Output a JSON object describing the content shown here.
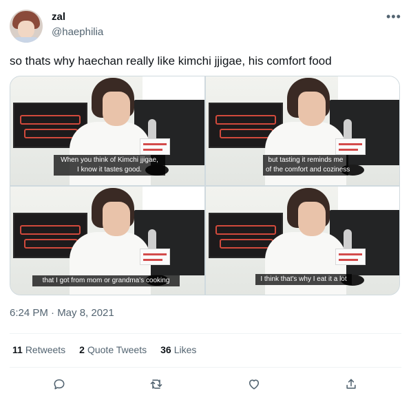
{
  "author": {
    "display_name": "zal",
    "handle": "@haephilia"
  },
  "tweet": {
    "text": "so thats why haechan really like kimchi jjigae, his comfort food",
    "timestamp": "6:24 PM · May 8, 2021"
  },
  "media": [
    {
      "subtitle_line1": "When you think of Kimchi jjigae,",
      "subtitle_line2": "I know it tastes good."
    },
    {
      "subtitle_line1": "but tasting it reminds me",
      "subtitle_line2": "of the comfort and coziness"
    },
    {
      "subtitle_line1": "that I got from mom or grandma's cooking",
      "subtitle_line2": ""
    },
    {
      "subtitle_line1": "I think that's why I eat it a lot",
      "subtitle_line2": ""
    }
  ],
  "stats": {
    "retweets_count": "11",
    "retweets_label": "Retweets",
    "quote_count": "2",
    "quote_label": "Quote Tweets",
    "likes_count": "36",
    "likes_label": "Likes"
  },
  "icons": {
    "more": "more-horizontal-icon",
    "reply": "reply-icon",
    "retweet": "retweet-icon",
    "like": "heart-icon",
    "share": "share-icon"
  },
  "colors": {
    "text": "#0f1419",
    "secondary_text": "#536471",
    "border": "#cfd9de"
  }
}
